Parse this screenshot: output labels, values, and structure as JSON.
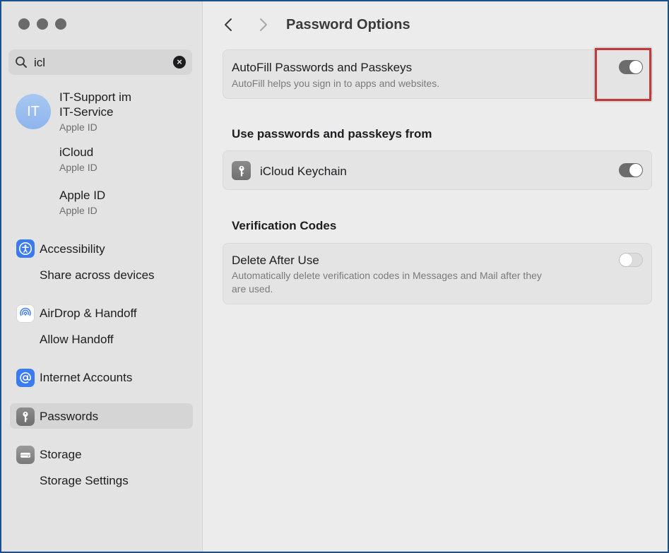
{
  "window": {
    "traffic_lights": [
      "close",
      "minimize",
      "zoom"
    ]
  },
  "sidebar": {
    "search": {
      "value": "icl",
      "icon": "search-icon",
      "clear_icon": "clear-icon"
    },
    "account": {
      "initials": "IT",
      "name_line1": "IT-Support im",
      "name_line2": "IT-Service",
      "subtitle": "Apple ID"
    },
    "results": [
      {
        "title": "iCloud",
        "subtitle": "Apple ID"
      },
      {
        "title": "Apple ID",
        "subtitle": "Apple ID"
      }
    ],
    "sections": [
      {
        "label": "Accessibility",
        "icon": "accessibility-icon",
        "icon_color": "#3b7bf0",
        "child": "Share across devices"
      },
      {
        "label": "AirDrop & Handoff",
        "icon": "airdrop-icon",
        "icon_color": "#ffffff",
        "child": "Allow Handoff"
      },
      {
        "label": "Internet Accounts",
        "icon": "at-sign-icon",
        "icon_color": "#3b7bf0",
        "child": ""
      },
      {
        "label": "Passwords",
        "icon": "key-icon",
        "icon_color": "#8a8a8a",
        "child": "",
        "selected": true
      },
      {
        "label": "Storage",
        "icon": "drive-icon",
        "icon_color": "#8a8a8a",
        "child": "Storage Settings"
      }
    ]
  },
  "main": {
    "title": "Password Options",
    "autofill": {
      "title": "AutoFill Passwords and Passkeys",
      "description": "AutoFill helps you sign in to apps and websites.",
      "enabled": true
    },
    "sources_heading": "Use passwords and passkeys from",
    "keychain": {
      "title": "iCloud Keychain",
      "icon": "key-icon",
      "enabled": true
    },
    "verification_heading": "Verification Codes",
    "delete_after_use": {
      "title": "Delete After Use",
      "description_line1": "Automatically delete verification codes in Messages and Mail after they",
      "description_line2": "are used.",
      "enabled": false
    }
  },
  "colors": {
    "highlight_border": "#c0393b",
    "frame_border": "#1f4e8c",
    "toggle_on": "#6c6c6c"
  }
}
